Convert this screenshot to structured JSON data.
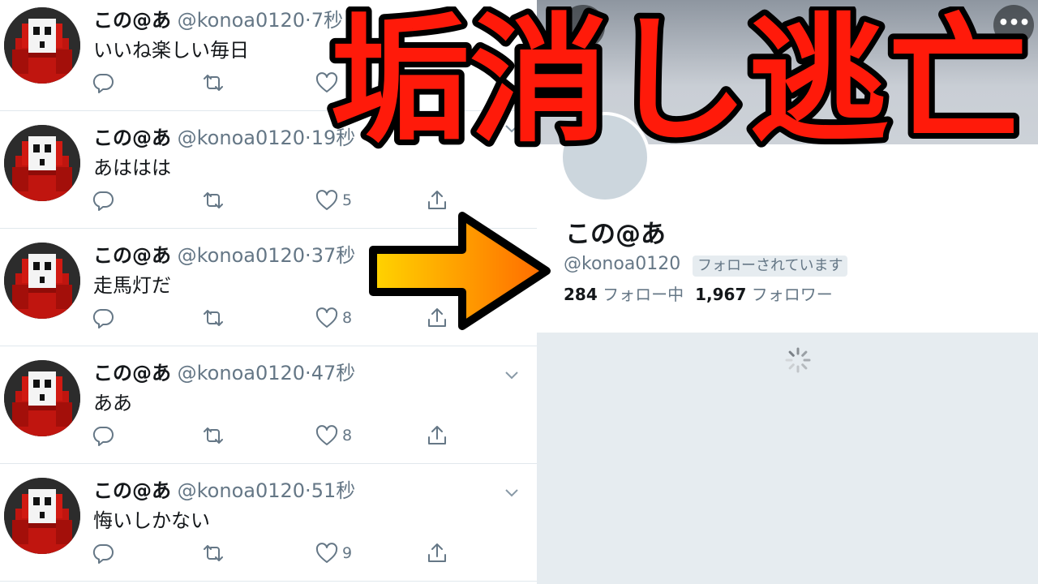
{
  "overlay": {
    "title": "垢消し逃亡",
    "title_color": "#ff1a0a",
    "arrow_colors": [
      "#ffd400",
      "#ff6a00"
    ]
  },
  "timeline": {
    "tweets": [
      {
        "name": "この@あ",
        "handle": "@konoa0120",
        "dot": "·",
        "time": "7秒",
        "text": "いいね楽しい毎日",
        "likes": ""
      },
      {
        "name": "この@あ",
        "handle": "@konoa0120",
        "dot": "·",
        "time": "19秒",
        "text": "あははは",
        "likes": "5"
      },
      {
        "name": "この@あ",
        "handle": "@konoa0120",
        "dot": "·",
        "time": "37秒",
        "text": "走馬灯だ",
        "likes": "8"
      },
      {
        "name": "この@あ",
        "handle": "@konoa0120",
        "dot": "·",
        "time": "47秒",
        "text": "ああ",
        "likes": "8"
      },
      {
        "name": "この@あ",
        "handle": "@konoa0120",
        "dot": "·",
        "time": "51秒",
        "text": "悔いしかない",
        "likes": "9"
      }
    ]
  },
  "profile": {
    "name": "この@あ",
    "handle": "@konoa0120",
    "follows_you": "フォローされています",
    "following_count": "284",
    "following_label": "フォロー中",
    "followers_count": "1,967",
    "followers_label": "フォロワー",
    "more_glyph": "•••"
  },
  "icons": [
    "reply-icon",
    "retweet-icon",
    "like-icon",
    "share-icon",
    "chevron-down-icon",
    "back-arrow-icon",
    "more-icon",
    "loading-spinner-icon"
  ]
}
